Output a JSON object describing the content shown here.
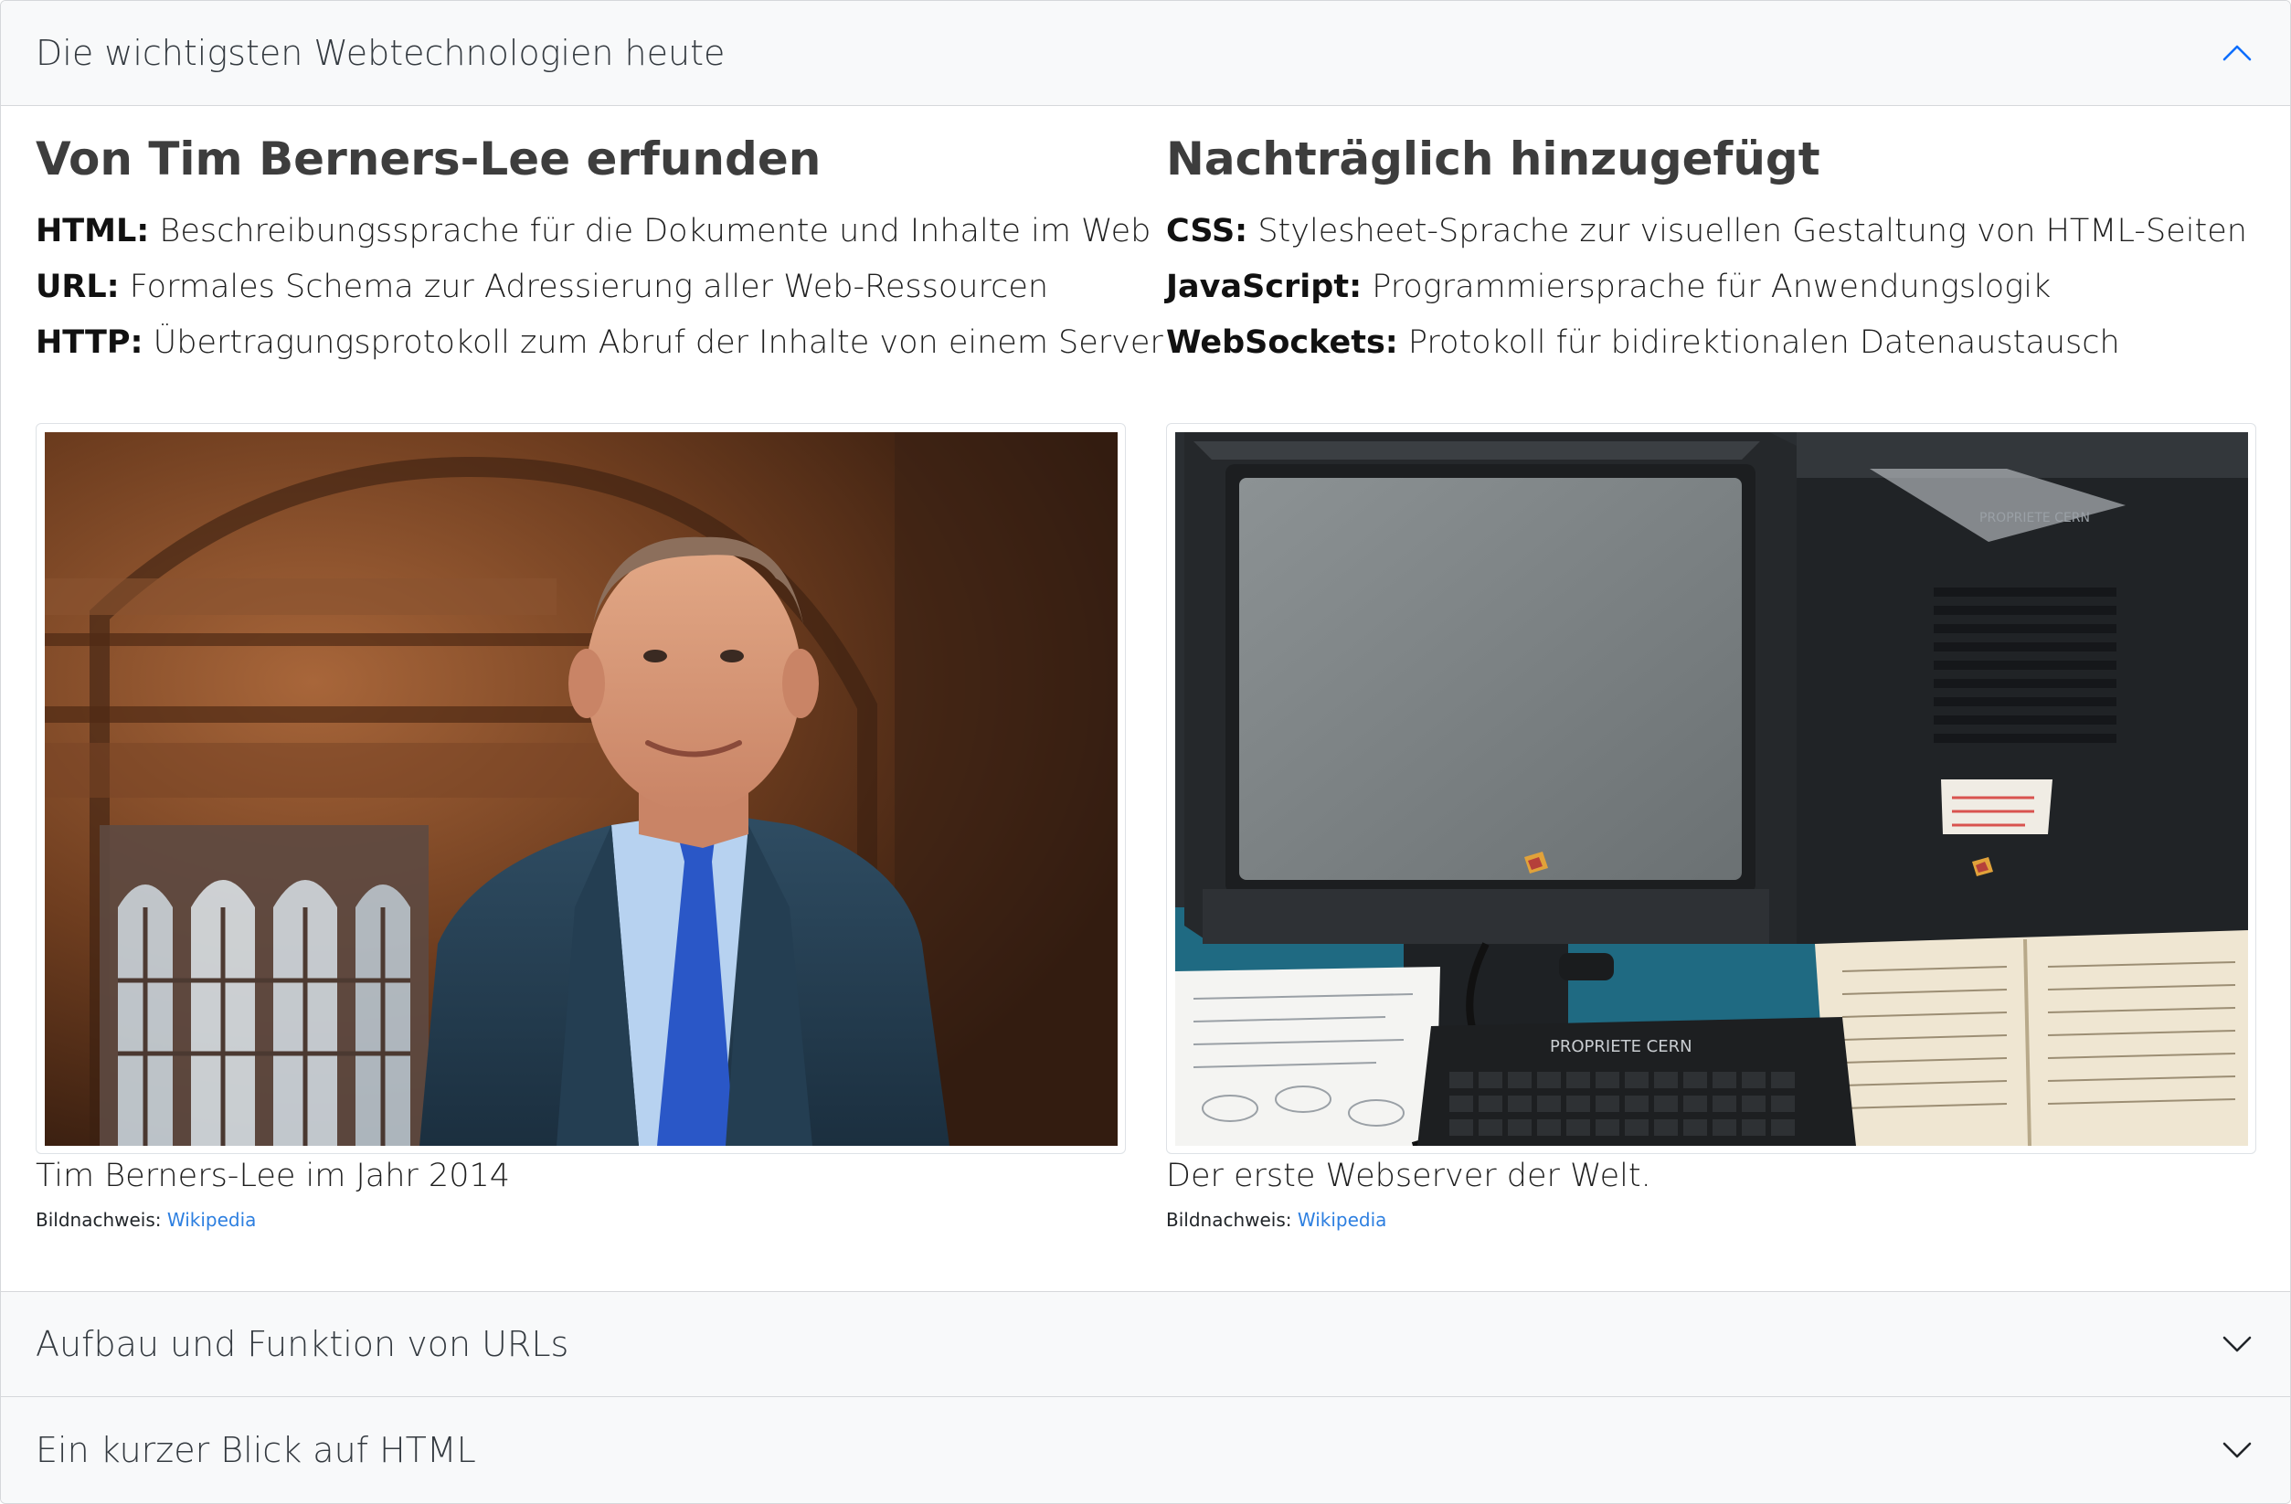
{
  "accordion": {
    "sections": [
      {
        "title": "Die wichtigsten Webtechnologien heute",
        "expanded": true
      },
      {
        "title": "Aufbau und Funktion von URLs",
        "expanded": false
      },
      {
        "title": "Ein kurzer Blick auf HTML",
        "expanded": false
      }
    ]
  },
  "left": {
    "heading": "Von Tim Berners-Lee erfunden",
    "items": [
      {
        "term": "HTML:",
        "desc": " Beschreibungssprache für die Dokumente und Inhalte im Web"
      },
      {
        "term": "URL:",
        "desc": " Formales Schema zur Adressierung aller Web-Ressourcen"
      },
      {
        "term": "HTTP:",
        "desc": " Übertragungsprotokoll zum Abruf der Inhalte von einem Server"
      }
    ],
    "caption": "Tim Berners-Lee im Jahr 2014",
    "credit_label": "Bildnachweis: ",
    "credit_link": "Wikipedia"
  },
  "right": {
    "heading": "Nachträglich hinzugefügt",
    "items": [
      {
        "term": "CSS:",
        "desc": " Stylesheet-Sprache zur visuellen Gestaltung von HTML-Seiten"
      },
      {
        "term": "JavaScript:",
        "desc": " Programmiersprache für Anwendungslogik"
      },
      {
        "term": "WebSockets:",
        "desc": " Protokoll für bidirektionalen Datenaustausch"
      }
    ],
    "caption": "Der erste Webserver der Welt.",
    "credit_label": "Bildnachweis: ",
    "credit_link": "Wikipedia",
    "sticker_text": "PROPRIETE CERN"
  },
  "colors": {
    "accent": "#0d6efd",
    "link": "#2d7fe0",
    "header_bg": "#f8f9fa",
    "border": "#d6d8db"
  }
}
